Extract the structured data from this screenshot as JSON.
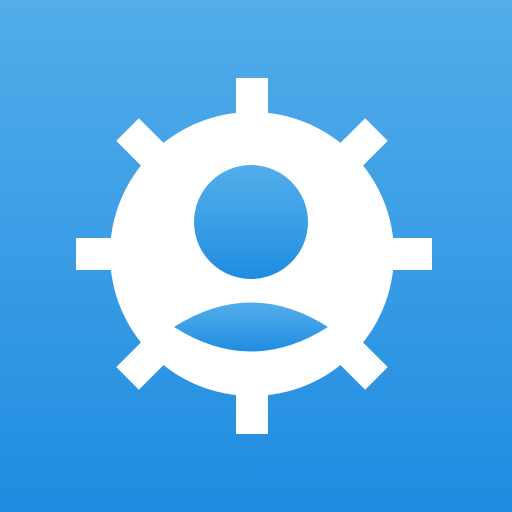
{
  "icon": {
    "name": "gear-user-icon",
    "background_top": "#53adea",
    "background_bottom": "#1f8ce0",
    "glyph_color": "#ffffff"
  }
}
